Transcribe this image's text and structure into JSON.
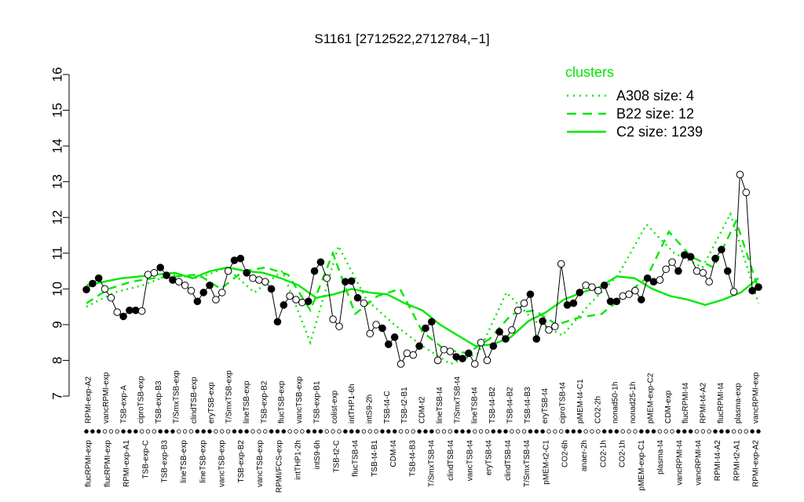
{
  "chart_data": {
    "type": "line",
    "title": "S1161 [2712522,2712784,−1]",
    "ylim": [
      7,
      16
    ],
    "yticks": [
      7,
      8,
      9,
      10,
      11,
      12,
      13,
      14,
      15,
      16
    ],
    "grid": false,
    "legend_position": "top-right",
    "legend": {
      "title": "clusters",
      "entries": [
        {
          "label": "A308 size: 4",
          "style": "dotted"
        },
        {
          "label": "B22 size: 12",
          "style": "dashed"
        },
        {
          "label": "C2 size: 1239",
          "style": "solid"
        }
      ]
    },
    "colors": {
      "cluster": "#00e800",
      "points": "#000000",
      "text": "#000000"
    },
    "labels_top": [
      "RPMI-exp-A2",
      "vancRPMI-exp",
      "TSB-exp-A",
      "ciproTSB-exp",
      "TSB-exp-B3",
      "T/SmxTSB-exp",
      "clindTSB-exp",
      "eryTSB-exp",
      "T/SmxTSB-exp",
      "lineTSB-exp",
      "TSB-exp-B2",
      "flucTSB-exp",
      "vancTSB-exp",
      "TSB-exp-B1",
      "colist-exp",
      "intTHP1-6h",
      "intS9-2h",
      "TSB-t4-C",
      "TSB-t2-B1",
      "CDM-t2",
      "lineTSB-t4",
      "T/SmxTSB-t4",
      "lineTSB-t4",
      "TSB-t4-B2",
      "TSB-t4-B2",
      "TSB-t4-B3",
      "eryTSB-t4",
      "ciproTSB-t4",
      "pMEM-t4-C1",
      "CO2-2h",
      "nonad50-1h",
      "nonad25-1h",
      "pMEM-exp-C2",
      "CDM-exp",
      "flucRPMI-t4",
      "RPMI-t4-A2",
      "flucRPMI-t4",
      "plasma-exp",
      "vancRPMI-exp"
    ],
    "labels_bottom": [
      "flucRPMI-exp",
      "flucRPMI-exp",
      "RPMI-exp-A1",
      "TSB-exp-C",
      "TSB-exp-B3",
      "lineTSB-exp",
      "lineTSB-exp",
      "vancTSB-exp",
      "TSB-exp-B2",
      "vancTSB-exp",
      "RPMI/FCS-exp",
      "intTHP1-2h",
      "intS9-6h",
      "TSB-t2-C",
      "flucTSB-t4",
      "TSB-t4-B1",
      "CDM-t4",
      "TSB-t4-B3",
      "T/SmxTSB-t4",
      "clindTSB-t4",
      "vancTSB-t4",
      "eryTSB-t4",
      "clindTSB-t4",
      "T/SmxTSB-t4",
      "pMEM-t2-C1",
      "CO2-6h",
      "anaer-2h",
      "CO2-1h",
      "CO2-1h",
      "pMEM-exp-C1",
      "plasma-t4",
      "vancRPMI-t4",
      "vancRPMI-t4",
      "RPMI-t4-A2",
      "RPMI-t2-A1",
      "RPMI-exp-A2"
    ],
    "points": [
      {
        "x": 1,
        "y": 9.98
      },
      {
        "x": 2,
        "y": 10.15
      },
      {
        "x": 3,
        "y": 10.3
      },
      {
        "x": 4,
        "y": 10.0
      },
      {
        "x": 5,
        "y": 9.75
      },
      {
        "x": 6,
        "y": 9.35
      },
      {
        "x": 7,
        "y": 9.23
      },
      {
        "x": 8,
        "y": 9.4
      },
      {
        "x": 9,
        "y": 9.4
      },
      {
        "x": 10,
        "y": 9.38
      },
      {
        "x": 11,
        "y": 10.4
      },
      {
        "x": 12,
        "y": 10.45
      },
      {
        "x": 13,
        "y": 10.6
      },
      {
        "x": 14,
        "y": 10.38
      },
      {
        "x": 15,
        "y": 10.25
      },
      {
        "x": 16,
        "y": 10.2
      },
      {
        "x": 17,
        "y": 10.1
      },
      {
        "x": 18,
        "y": 9.95
      },
      {
        "x": 19,
        "y": 9.65
      },
      {
        "x": 20,
        "y": 9.9
      },
      {
        "x": 21,
        "y": 10.1
      },
      {
        "x": 22,
        "y": 9.7
      },
      {
        "x": 23,
        "y": 9.9
      },
      {
        "x": 24,
        "y": 10.5
      },
      {
        "x": 25,
        "y": 10.8
      },
      {
        "x": 26,
        "y": 10.85
      },
      {
        "x": 27,
        "y": 10.45
      },
      {
        "x": 28,
        "y": 10.3
      },
      {
        "x": 29,
        "y": 10.25
      },
      {
        "x": 30,
        "y": 10.2
      },
      {
        "x": 31,
        "y": 10.0
      },
      {
        "x": 32,
        "y": 9.08
      },
      {
        "x": 33,
        "y": 9.55
      },
      {
        "x": 34,
        "y": 9.8
      },
      {
        "x": 35,
        "y": 9.7
      },
      {
        "x": 36,
        "y": 9.62
      },
      {
        "x": 37,
        "y": 9.65
      },
      {
        "x": 38,
        "y": 10.5
      },
      {
        "x": 39,
        "y": 10.75
      },
      {
        "x": 40,
        "y": 10.3
      },
      {
        "x": 41,
        "y": 9.15
      },
      {
        "x": 42,
        "y": 8.95
      },
      {
        "x": 43,
        "y": 10.2
      },
      {
        "x": 44,
        "y": 10.22
      },
      {
        "x": 45,
        "y": 9.75
      },
      {
        "x": 46,
        "y": 9.6
      },
      {
        "x": 47,
        "y": 8.75
      },
      {
        "x": 48,
        "y": 9.0
      },
      {
        "x": 49,
        "y": 8.9
      },
      {
        "x": 50,
        "y": 8.45
      },
      {
        "x": 51,
        "y": 8.65
      },
      {
        "x": 52,
        "y": 7.9
      },
      {
        "x": 53,
        "y": 8.2
      },
      {
        "x": 54,
        "y": 8.15
      },
      {
        "x": 55,
        "y": 8.4
      },
      {
        "x": 56,
        "y": 8.9
      },
      {
        "x": 57,
        "y": 9.08
      },
      {
        "x": 58,
        "y": 8.0
      },
      {
        "x": 59,
        "y": 8.3
      },
      {
        "x": 60,
        "y": 8.25
      },
      {
        "x": 61,
        "y": 8.1
      },
      {
        "x": 62,
        "y": 8.05
      },
      {
        "x": 63,
        "y": 8.2
      },
      {
        "x": 64,
        "y": 7.9
      },
      {
        "x": 65,
        "y": 8.5
      },
      {
        "x": 66,
        "y": 8.0
      },
      {
        "x": 67,
        "y": 8.4
      },
      {
        "x": 68,
        "y": 8.8
      },
      {
        "x": 69,
        "y": 8.6
      },
      {
        "x": 70,
        "y": 8.85
      },
      {
        "x": 71,
        "y": 9.4
      },
      {
        "x": 72,
        "y": 9.6
      },
      {
        "x": 73,
        "y": 9.85
      },
      {
        "x": 74,
        "y": 8.6
      },
      {
        "x": 75,
        "y": 9.1
      },
      {
        "x": 76,
        "y": 8.85
      },
      {
        "x": 77,
        "y": 8.95
      },
      {
        "x": 78,
        "y": 10.7
      },
      {
        "x": 79,
        "y": 9.55
      },
      {
        "x": 80,
        "y": 9.6
      },
      {
        "x": 81,
        "y": 9.9
      },
      {
        "x": 82,
        "y": 10.1
      },
      {
        "x": 83,
        "y": 10.05
      },
      {
        "x": 84,
        "y": 9.95
      },
      {
        "x": 85,
        "y": 10.1
      },
      {
        "x": 86,
        "y": 9.65
      },
      {
        "x": 87,
        "y": 9.65
      },
      {
        "x": 88,
        "y": 9.8
      },
      {
        "x": 89,
        "y": 9.85
      },
      {
        "x": 90,
        "y": 9.95
      },
      {
        "x": 91,
        "y": 9.7
      },
      {
        "x": 92,
        "y": 10.3
      },
      {
        "x": 93,
        "y": 10.2
      },
      {
        "x": 94,
        "y": 10.25
      },
      {
        "x": 95,
        "y": 10.55
      },
      {
        "x": 96,
        "y": 10.75
      },
      {
        "x": 97,
        "y": 10.5
      },
      {
        "x": 98,
        "y": 10.95
      },
      {
        "x": 99,
        "y": 10.9
      },
      {
        "x": 100,
        "y": 10.5
      },
      {
        "x": 101,
        "y": 10.45
      },
      {
        "x": 102,
        "y": 10.2
      },
      {
        "x": 103,
        "y": 10.85
      },
      {
        "x": 104,
        "y": 11.1
      },
      {
        "x": 105,
        "y": 10.5
      },
      {
        "x": 106,
        "y": 9.92
      },
      {
        "x": 107,
        "y": 13.2
      },
      {
        "x": 108,
        "y": 12.7
      },
      {
        "x": 109,
        "y": 9.95
      },
      {
        "x": 110,
        "y": 10.05
      }
    ],
    "series": [
      {
        "name": "C2 size: 1239",
        "style": "solid",
        "values": [
          10.1,
          10.2,
          10.3,
          10.35,
          10.4,
          10.45,
          10.3,
          10.5,
          10.6,
          10.5,
          10.45,
          10.3,
          10.1,
          9.75,
          9.85,
          10.0,
          9.9,
          9.85,
          9.6,
          9.4,
          9.0,
          8.7,
          8.4,
          8.45,
          8.65,
          9.1,
          9.35,
          9.7,
          9.9,
          10.05,
          10.35,
          10.3,
          10.0,
          9.8,
          9.7,
          9.55,
          9.7,
          9.9,
          10.3
        ]
      },
      {
        "name": "B22 size: 12",
        "style": "dashed",
        "values": [
          9.6,
          10.0,
          10.2,
          10.3,
          10.35,
          10.4,
          10.0,
          10.5,
          10.6,
          10.4,
          9.4,
          11.0,
          9.3,
          9.8,
          10.0,
          8.8,
          8.3,
          8.2,
          8.6,
          9.3,
          9.4,
          9.0,
          9.2,
          9.3,
          9.8,
          10.3,
          11.6,
          10.9,
          10.6,
          11.9,
          10.0
        ]
      },
      {
        "name": "A308 size: 4",
        "style": "dotted",
        "values": [
          9.5,
          9.9,
          10.1,
          10.4,
          10.3,
          10.6,
          9.9,
          10.5,
          8.5,
          11.2,
          9.7,
          9.0,
          8.4,
          7.9,
          8.2,
          9.9,
          9.1,
          8.7,
          9.6,
          10.4,
          11.8,
          11.0,
          10.6,
          12.1,
          9.6
        ]
      }
    ]
  }
}
